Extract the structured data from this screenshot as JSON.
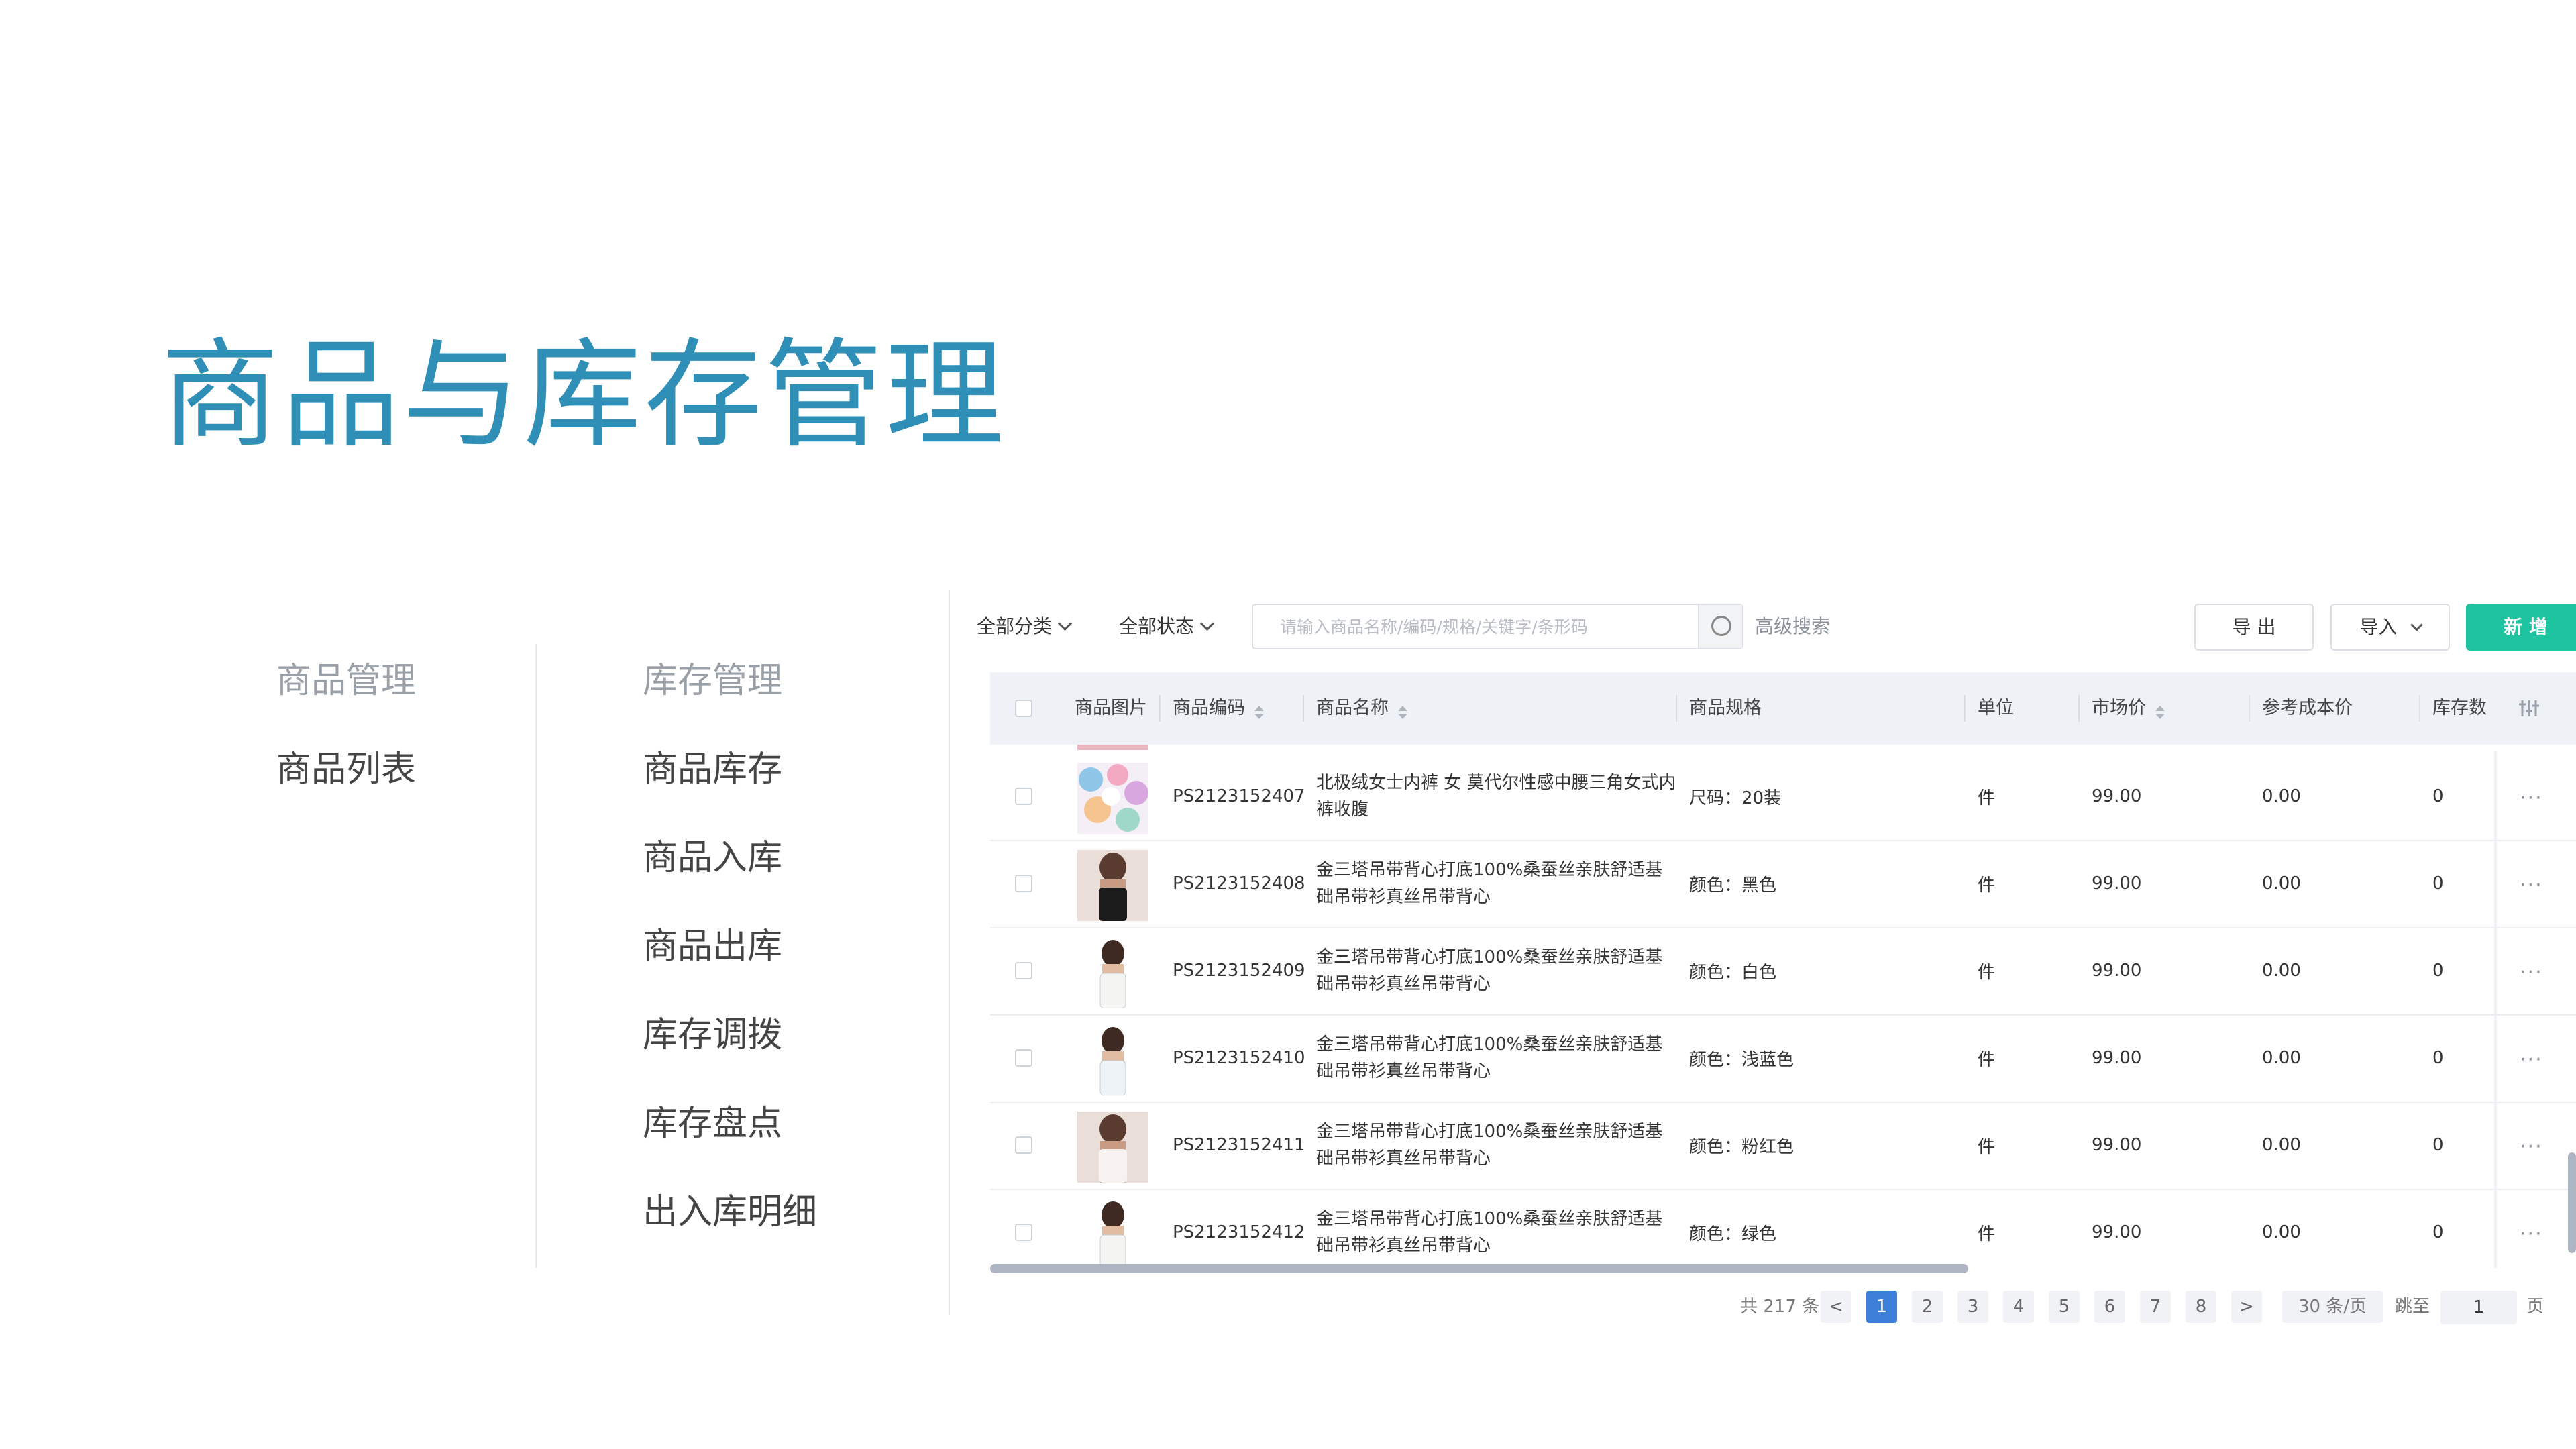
{
  "title": "商品与库存管理",
  "menu": {
    "product_header": "商品管理",
    "product_items": [
      "商品列表"
    ],
    "stock_header": "库存管理",
    "stock_items": [
      "商品库存",
      "商品入库",
      "商品出库",
      "库存调拨",
      "库存盘点",
      "出入库明细"
    ]
  },
  "toolbar": {
    "category": "全部分类",
    "status": "全部状态",
    "search_placeholder": "请输入商品名称/编码/规格/关键字/条形码",
    "advanced": "高级搜索",
    "export": "导 出",
    "import": "导入",
    "new": "新 增",
    "accent_color": "#1ec3a0"
  },
  "table": {
    "columns": [
      "商品图片",
      "商品编码",
      "商品名称",
      "商品规格",
      "单位",
      "市场价",
      "参考成本价",
      "库存数"
    ],
    "rows": [
      {
        "code": "PS2123152407",
        "name": "北极绒女士内裤 女 莫代尔性感中腰三角女式内裤收腹",
        "spec": "尺码：20装",
        "unit": "件",
        "price": "99.00",
        "cost": "0.00",
        "stock": "0",
        "more": "···"
      },
      {
        "code": "PS2123152408",
        "name": "金三塔吊带背心打底100%桑蚕丝亲肤舒适基础吊带衫真丝吊带背心",
        "spec": "颜色：黑色",
        "unit": "件",
        "price": "99.00",
        "cost": "0.00",
        "stock": "0",
        "more": "···"
      },
      {
        "code": "PS2123152409",
        "name": "金三塔吊带背心打底100%桑蚕丝亲肤舒适基础吊带衫真丝吊带背心",
        "spec": "颜色：白色",
        "unit": "件",
        "price": "99.00",
        "cost": "0.00",
        "stock": "0",
        "more": "···"
      },
      {
        "code": "PS2123152410",
        "name": "金三塔吊带背心打底100%桑蚕丝亲肤舒适基础吊带衫真丝吊带背心",
        "spec": "颜色：浅蓝色",
        "unit": "件",
        "price": "99.00",
        "cost": "0.00",
        "stock": "0",
        "more": "···"
      },
      {
        "code": "PS2123152411",
        "name": "金三塔吊带背心打底100%桑蚕丝亲肤舒适基础吊带衫真丝吊带背心",
        "spec": "颜色：粉红色",
        "unit": "件",
        "price": "99.00",
        "cost": "0.00",
        "stock": "0",
        "more": "···"
      },
      {
        "code": "PS2123152412",
        "name": "金三塔吊带背心打底100%桑蚕丝亲肤舒适基础吊带衫真丝吊带背心",
        "spec": "颜色：绿色",
        "unit": "件",
        "price": "99.00",
        "cost": "0.00",
        "stock": "0",
        "more": "···"
      }
    ]
  },
  "pagination": {
    "total": "共 217 条",
    "prev": "<",
    "pages": [
      "1",
      "2",
      "3",
      "4",
      "5",
      "6",
      "7",
      "8"
    ],
    "next": ">",
    "page_size": "30 条/页",
    "jump_label": "跳至",
    "jump_value": "1",
    "page_unit": "页"
  }
}
